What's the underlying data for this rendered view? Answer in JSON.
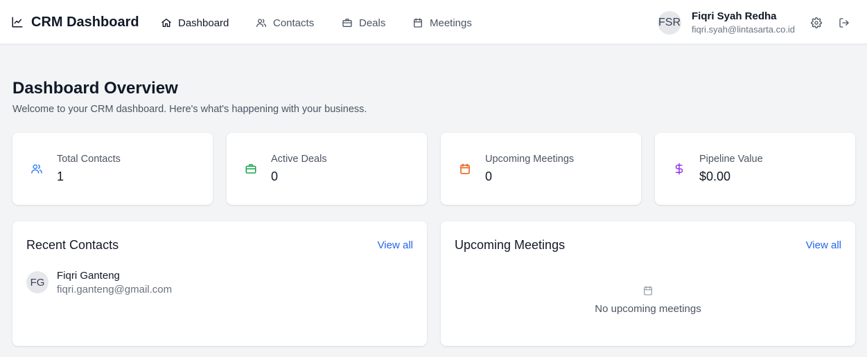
{
  "app": {
    "title": "CRM Dashboard"
  },
  "nav": {
    "items": [
      {
        "label": "Dashboard",
        "icon": "home-icon",
        "active": true
      },
      {
        "label": "Contacts",
        "icon": "users-icon",
        "active": false
      },
      {
        "label": "Deals",
        "icon": "briefcase-icon",
        "active": false
      },
      {
        "label": "Meetings",
        "icon": "calendar-icon",
        "active": false
      }
    ]
  },
  "user": {
    "initials": "FSR",
    "name": "Fiqri Syah Redha",
    "email": "fiqri.syah@lintasarta.co.id"
  },
  "page": {
    "title": "Dashboard Overview",
    "subtitle": "Welcome to your CRM dashboard. Here's what's happening with your business."
  },
  "stats": [
    {
      "label": "Total Contacts",
      "value": "1",
      "icon": "users-icon",
      "color": "#3b82f6"
    },
    {
      "label": "Active Deals",
      "value": "0",
      "icon": "briefcase-icon",
      "color": "#16a34a"
    },
    {
      "label": "Upcoming Meetings",
      "value": "0",
      "icon": "calendar-icon",
      "color": "#ea580c"
    },
    {
      "label": "Pipeline Value",
      "value": "$0.00",
      "icon": "dollar-icon",
      "color": "#9333ea"
    }
  ],
  "recent_contacts": {
    "title": "Recent Contacts",
    "view_all": "View all",
    "items": [
      {
        "initials": "FG",
        "name": "Fiqri Ganteng",
        "email": "fiqri.ganteng@gmail.com"
      }
    ]
  },
  "upcoming_meetings": {
    "title": "Upcoming Meetings",
    "view_all": "View all",
    "empty_text": "No upcoming meetings"
  },
  "colors": {
    "link": "#2563eb",
    "background": "#f3f4f6"
  }
}
